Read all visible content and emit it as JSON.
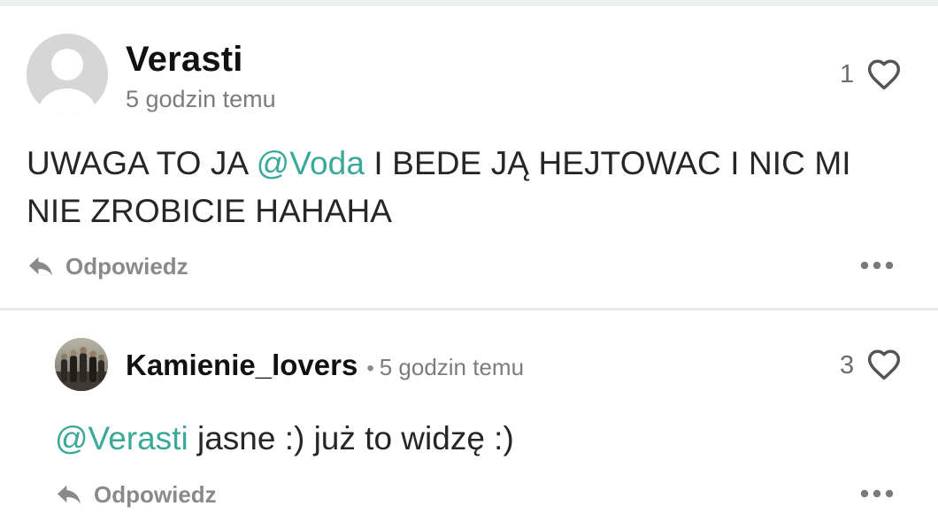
{
  "comments": [
    {
      "username": "Verasti",
      "time": "5 godzin temu",
      "likes": "1",
      "mention": "@Voda",
      "text_before": "UWAGA TO JA ",
      "text_after": " I BEDE JĄ HEJTOWAC I NIC MI NIE ZROBICIE HAHAHA",
      "reply_label": "Odpowiedz"
    },
    {
      "username": "Kamienie_lovers",
      "separator": "•",
      "time": "5 godzin temu",
      "likes": "3",
      "mention": "@Verasti",
      "text_after": " jasne :) już to widzę :)",
      "reply_label": "Odpowiedz"
    }
  ],
  "colors": {
    "mention": "#3aa99a",
    "text": "#262626",
    "muted": "#7c7c7c"
  },
  "icons": [
    "default-avatar-icon",
    "heart-icon",
    "reply-arrow-icon",
    "more-options-icon"
  ]
}
